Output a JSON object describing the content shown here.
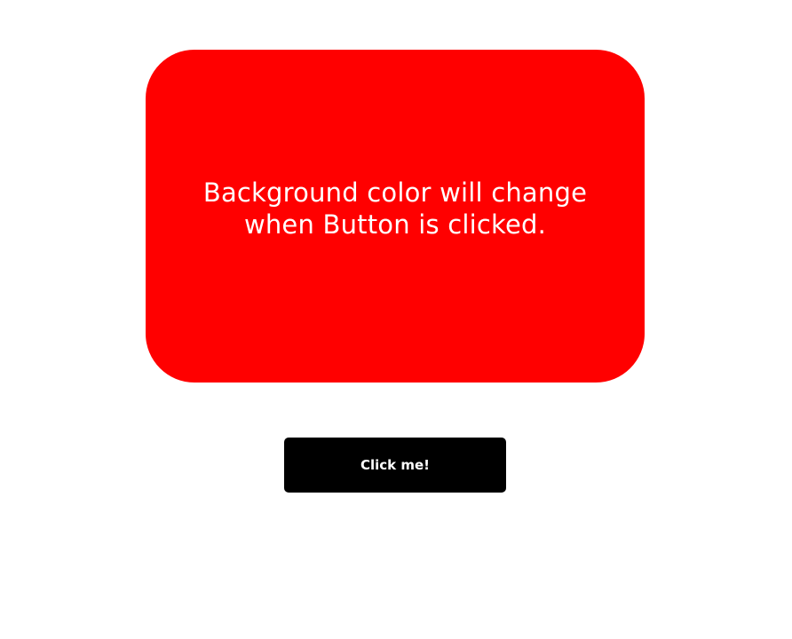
{
  "colors": {
    "page_background": "#ffffff",
    "box_background": "#ff0000",
    "box_text": "#ffffff",
    "button_background": "#000000",
    "button_text": "#ffffff"
  },
  "color_box": {
    "message": "Background color will change when Button is clicked."
  },
  "button": {
    "label": "Click me!"
  }
}
